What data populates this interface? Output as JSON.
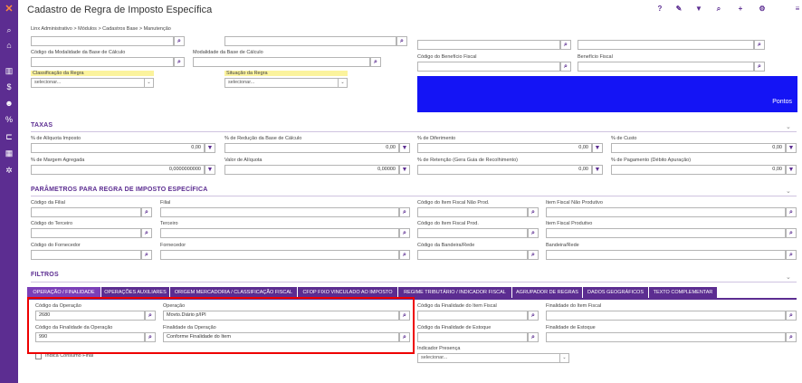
{
  "sidebar": {
    "logo": "✕",
    "icons": [
      "search-icon",
      "home-icon",
      "chart-icon",
      "dollar-icon",
      "users-icon",
      "percent-icon",
      "cart-icon",
      "calculator-icon",
      "settings-icon"
    ]
  },
  "header": {
    "title": "Cadastro de Regra de Imposto Específica",
    "icons": {
      "help": "?",
      "eraser": "✎",
      "filter": "▼",
      "search": "🔍",
      "add": "+",
      "gear": "⚙",
      "menu": "≡"
    }
  },
  "breadcrumb": "Linx Administrativo  >  Módulos  >  Cadastros Base  >  Manutenção",
  "top": {
    "cod_modalidade_label": "Código da Modalidade da Base de Cálculo",
    "modalidade_label": "Modalidade da Base de Cálculo",
    "classificacao_label": "Classificação da Regra",
    "classificacao_value": "selecionar...",
    "situacao_label": "Situação da Regra",
    "situacao_value": "selecionar...",
    "cod_beneficio_label": "Código do Benefício Fiscal",
    "beneficio_label": "Benefício Fiscal",
    "pontos": "Pontos"
  },
  "taxas": {
    "title": "TAXAS",
    "aliquota_label": "% de Alíquota Imposto",
    "aliquota_value": "0,00",
    "reducao_label": "% de Redução da Base de Cálculo",
    "reducao_value": "0,00",
    "diferimento_label": "% de Diferimento",
    "diferimento_value": "0,00",
    "custo_label": "% de Custo",
    "custo_value": "0,00",
    "margem_label": "% de Margem Agregada",
    "margem_value": "0,0000000000",
    "valor_aliquota_label": "Valor de Alíquota",
    "valor_aliquota_value": "0,00000",
    "retencao_label": "% de Retenção (Gera Guia de Recolhimento)",
    "retencao_value": "0,00",
    "pagamento_label": "% de Pagamento (Débito Apuração)",
    "pagamento_value": "0,00"
  },
  "parametros": {
    "title": "PARÂMETROS PARA REGRA DE IMPOSTO ESPECÍFICA",
    "cod_filial": "Código da Filial",
    "filial": "Filial",
    "cod_item_nao_prod": "Código do Item Fiscal Não Prod.",
    "item_nao_prod": "Item Fiscal Não Produtivo",
    "cod_terceiro": "Código do Terceiro",
    "terceiro": "Terceiro",
    "cod_item_prod": "Código do Item Fiscal Prod.",
    "item_prod": "Item Fiscal Produtivo",
    "cod_fornecedor": "Código do Fornecedor",
    "fornecedor": "Fornecedor",
    "cod_bandeira": "Código da Bandeira/Rede",
    "bandeira": "Bandeira/Rede"
  },
  "filtros": {
    "title": "FILTROS",
    "tabs": [
      "OPERAÇÃO / FINALIDADE",
      "OPERAÇÕES AUXILIARES",
      "ORIGEM MERCADORIA / CLASSIFICAÇÃO FISCAL",
      "CFOP FIXO VINCULADO AO IMPOSTO",
      "REGIME TRIBUTÁRIO / INDICADOR FISCAL",
      "AGRUPADOR DE REGRAS",
      "DADOS GEOGRÁFICOS",
      "TEXTO COMPLEMENTAR"
    ],
    "cod_operacao_label": "Código da Operação",
    "cod_operacao_value": "2680",
    "operacao_label": "Operação",
    "operacao_value": "Movto.Diário p/IPI",
    "cod_finalidade_label": "Código da Finalidade da Operação",
    "cod_finalidade_value": "990",
    "finalidade_label": "Finalidade da Operação",
    "finalidade_value": "Conforme Finalidade do Item",
    "cod_fin_item_label": "Código da Finalidade do Item Fiscal",
    "fin_item_label": "Finalidade do Item Fiscal",
    "cod_fin_estoque_label": "Código da Finalidade de Estoque",
    "fin_estoque_label": "Finalidade de Estoque",
    "indicador_label": "Indicador Presença",
    "indicador_value": "selecionar...",
    "consumo_label": "Indica Consumo Final"
  }
}
